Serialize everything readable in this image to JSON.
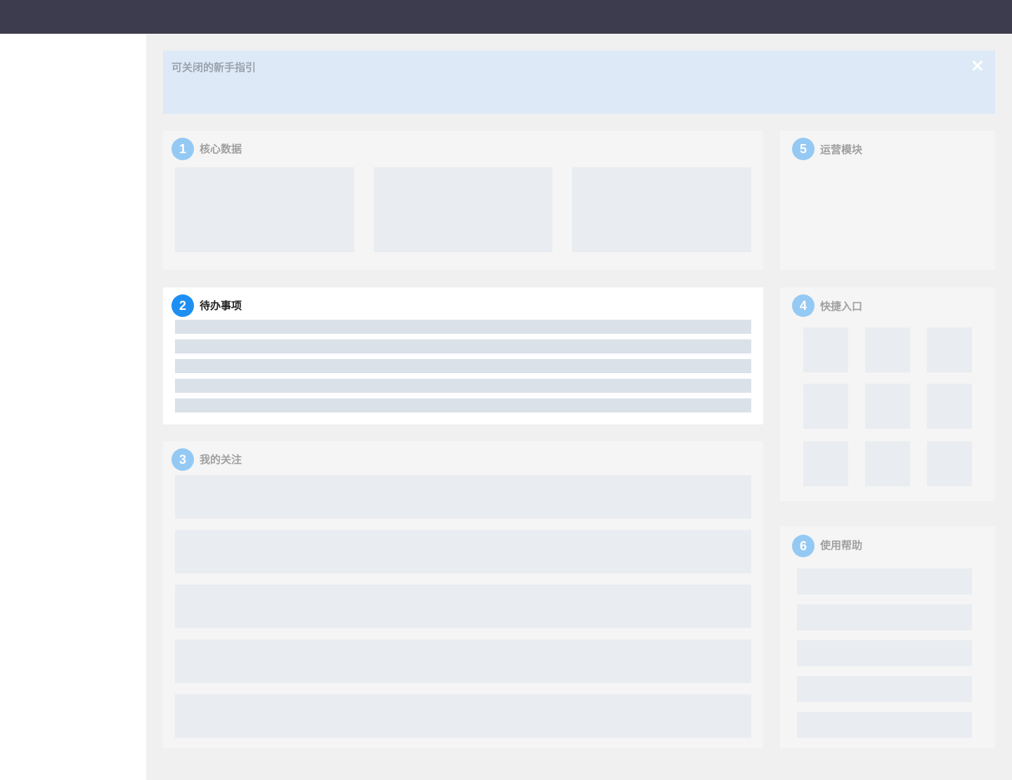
{
  "guide": {
    "title": "可关闭的新手指引"
  },
  "panels": {
    "core": {
      "number": "1",
      "title": "核心数据"
    },
    "todo": {
      "number": "2",
      "title": "待办事项"
    },
    "follow": {
      "number": "3",
      "title": "我的关注"
    },
    "shortcut": {
      "number": "4",
      "title": "快捷入口"
    },
    "ops": {
      "number": "5",
      "title": "运营模块"
    },
    "help": {
      "number": "6",
      "title": "使用帮助"
    }
  },
  "colors": {
    "topbar": "#3d3c4e",
    "content_bg": "#f0f0f0",
    "guide_bg": "#dde9f7",
    "badge": "#94c9f4",
    "badge_active": "#1e8ff2"
  },
  "icons": {
    "guide_close": "close-icon"
  }
}
